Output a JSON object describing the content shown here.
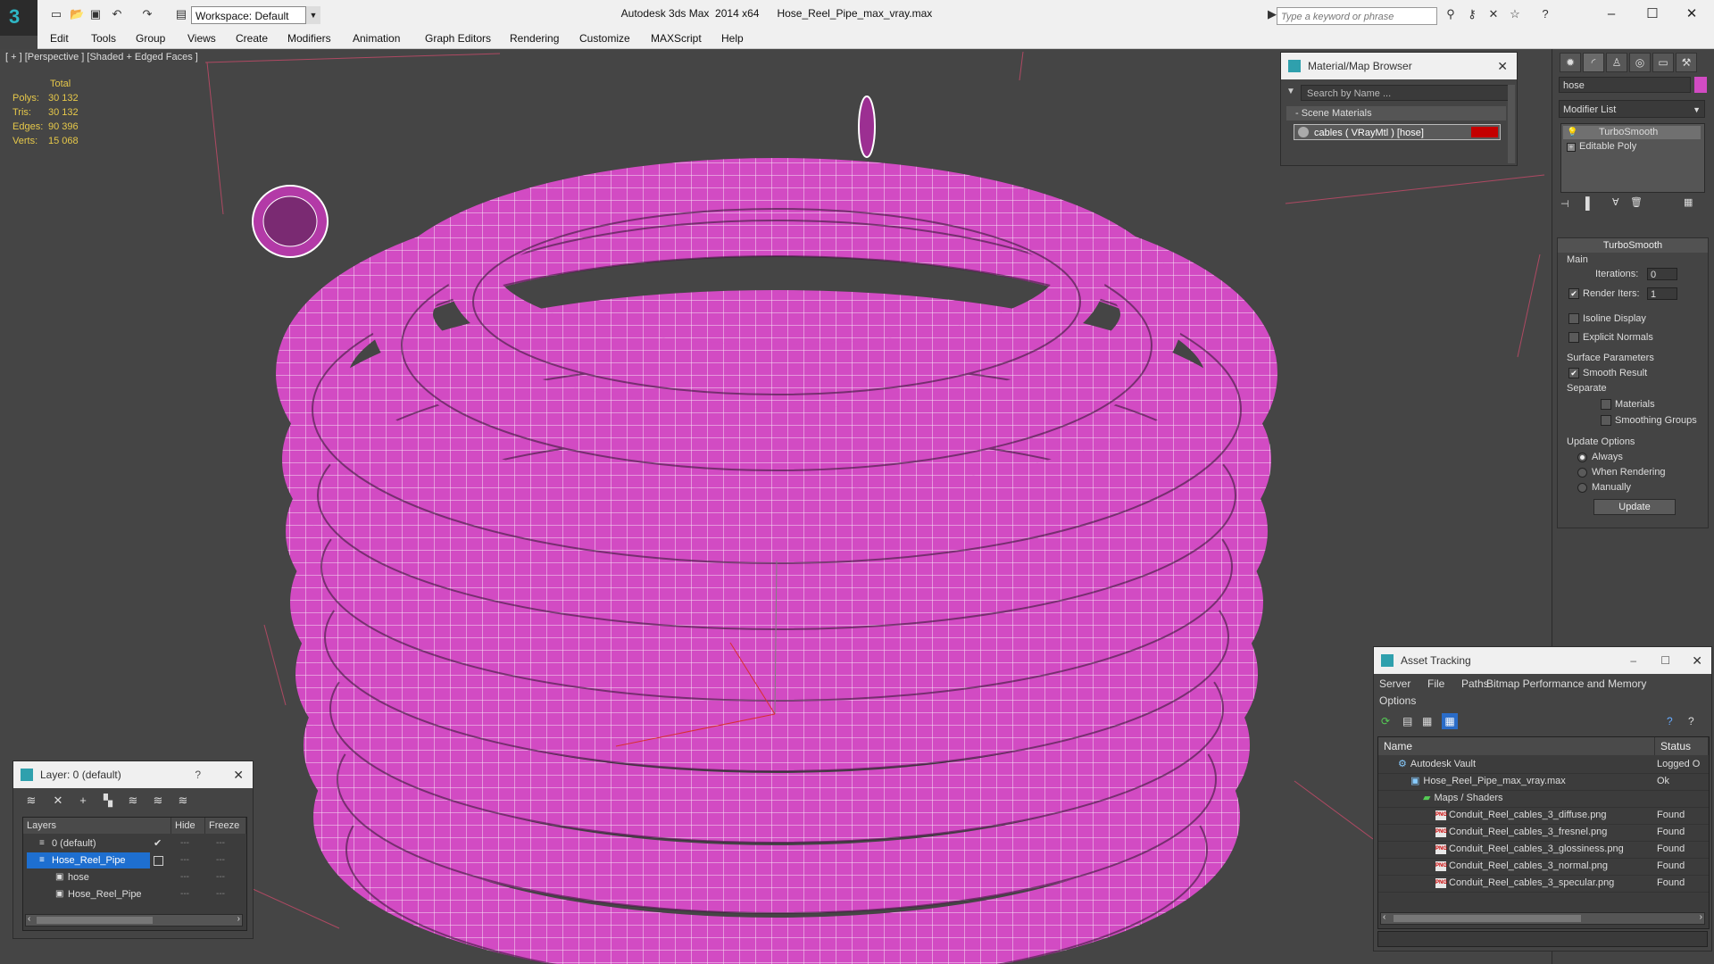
{
  "titlebar": {
    "workspace": "Workspace: Default",
    "app_title": "Autodesk 3ds Max  2014 x64      Hose_Reel_Pipe_max_vray.max",
    "search_placeholder": "Type a keyword or phrase"
  },
  "menu": [
    "Edit",
    "Tools",
    "Group",
    "Views",
    "Create",
    "Modifiers",
    "Animation",
    "Graph Editors",
    "Rendering",
    "Customize",
    "MAXScript",
    "Help"
  ],
  "viewport": {
    "label": "[ + ] [Perspective ] [Shaded + Edged Faces ]",
    "stats": {
      "header": "Total",
      "rows": [
        {
          "label": "Polys:",
          "value": "30 132"
        },
        {
          "label": "Tris:",
          "value": "30 132"
        },
        {
          "label": "Edges:",
          "value": "90 396"
        },
        {
          "label": "Verts:",
          "value": "15 068"
        }
      ]
    },
    "object_color": "#d24bc3",
    "wire_color": "#ffffff"
  },
  "material_browser": {
    "title": "Material/Map Browser",
    "search_placeholder": "Search by Name ...",
    "section": "- Scene Materials",
    "item": "cables  ( VRayMtl ) [hose]"
  },
  "command_panel": {
    "object_name": "hose",
    "modifier_list": "Modifier List",
    "stack": [
      "TurboSmooth",
      "Editable Poly"
    ],
    "turbosmooth": {
      "title": "TurboSmooth",
      "main_label": "Main",
      "iterations_label": "Iterations:",
      "iterations_value": "0",
      "render_iters_label": "Render Iters:",
      "render_iters_value": "1",
      "isoline": "Isoline Display",
      "explicit_normals": "Explicit Normals",
      "surface_params": "Surface Parameters",
      "smooth_result": "Smooth Result",
      "separate": "Separate",
      "materials": "Materials",
      "smoothing_groups": "Smoothing Groups",
      "update_options": "Update Options",
      "always": "Always",
      "when_rendering": "When Rendering",
      "manually": "Manually",
      "update_button": "Update"
    }
  },
  "layer_panel": {
    "title": "Layer: 0 (default)",
    "help": "?",
    "col_layers": "Layers",
    "col_hide": "Hide",
    "col_freeze": "Freeze",
    "rows": [
      {
        "name": "0 (default)",
        "indent": 1
      },
      {
        "name": "Hose_Reel_Pipe",
        "indent": 1,
        "selected": true
      },
      {
        "name": "hose",
        "indent": 2
      },
      {
        "name": "Hose_Reel_Pipe",
        "indent": 2
      }
    ]
  },
  "asset_tracking": {
    "title": "Asset Tracking",
    "menu": [
      "Server",
      "File",
      "Paths",
      "Bitmap Performance and Memory",
      "Options"
    ],
    "col_name": "Name",
    "col_status": "Status",
    "rows": [
      {
        "name": "Autodesk Vault",
        "status": "Logged O",
        "indent": 1,
        "icon": "vault"
      },
      {
        "name": "Hose_Reel_Pipe_max_vray.max",
        "status": "Ok",
        "indent": 2,
        "icon": "max"
      },
      {
        "name": "Maps / Shaders",
        "status": "",
        "indent": 3,
        "icon": "folder"
      },
      {
        "name": "Conduit_Reel_cables_3_diffuse.png",
        "status": "Found",
        "indent": 4,
        "icon": "png"
      },
      {
        "name": "Conduit_Reel_cables_3_fresnel.png",
        "status": "Found",
        "indent": 4,
        "icon": "png"
      },
      {
        "name": "Conduit_Reel_cables_3_glossiness.png",
        "status": "Found",
        "indent": 4,
        "icon": "png"
      },
      {
        "name": "Conduit_Reel_cables_3_normal.png",
        "status": "Found",
        "indent": 4,
        "icon": "png"
      },
      {
        "name": "Conduit_Reel_cables_3_specular.png",
        "status": "Found",
        "indent": 4,
        "icon": "png"
      }
    ]
  }
}
